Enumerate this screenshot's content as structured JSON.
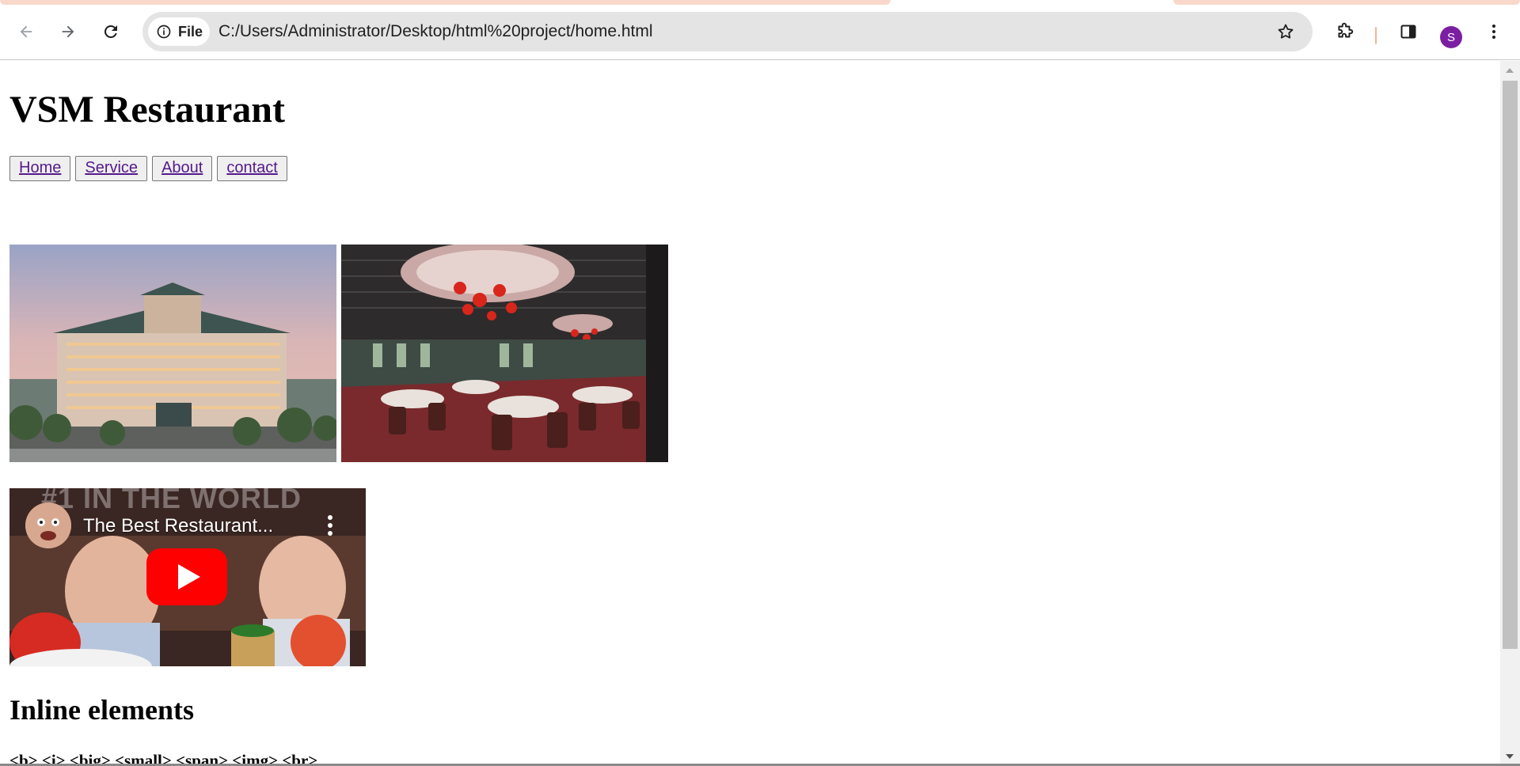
{
  "browser": {
    "address_bar": {
      "site_chip_label": "File",
      "url": "C:/Users/Administrator/Desktop/html%20project/home.html"
    },
    "profile_initial": "S",
    "icons": [
      "back-arrow-icon",
      "forward-arrow-icon",
      "reload-icon",
      "info-icon",
      "star-icon",
      "extensions-icon",
      "side-panel-icon",
      "kebab-menu-icon"
    ],
    "colors": {
      "tab_accent": "#f9d8cb",
      "avatar": "#7b1fa2",
      "link": "#551a8b"
    }
  },
  "page": {
    "title": "VSM Restaurant",
    "nav": [
      {
        "label": "Home"
      },
      {
        "label": "Service"
      },
      {
        "label": "About"
      },
      {
        "label": "contact"
      }
    ],
    "video": {
      "title": "The Best Restaurant...",
      "thumbnail_overlay_text": "#1 IN THE WORLD"
    },
    "section_heading": "Inline elements",
    "tags_line": "<b> <i> <big> <small> <span> <img> <br>"
  }
}
